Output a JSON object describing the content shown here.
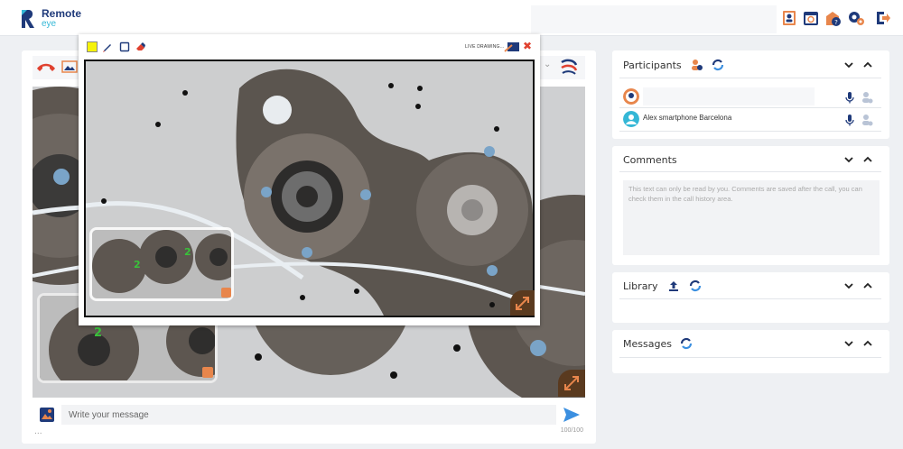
{
  "app": {
    "logo_line1": "Remote",
    "logo_line2": "eye"
  },
  "header": {
    "icons": [
      "contacts-icon",
      "history-icon",
      "help-icon",
      "settings-icon",
      "logout-icon"
    ]
  },
  "call": {
    "toolbar_icons": [
      "hangup-icon",
      "camera-switch-icon",
      "dropdown-icon",
      "brand-icon"
    ],
    "message_placeholder": "Write your message",
    "message_counter": "100/100",
    "message_footer": "..."
  },
  "drawing": {
    "tools": [
      "yellow-color-icon",
      "pen-icon",
      "rectangle-icon",
      "eraser-icon"
    ],
    "live_label": "LIVE DRAWING...",
    "close_label": "✖"
  },
  "participants": {
    "title": "Participants",
    "items": [
      {
        "name": "",
        "avatar": "support-agent-avatar"
      },
      {
        "name": "Alex smartphone Barcelona",
        "avatar": "user-avatar"
      }
    ]
  },
  "comments": {
    "title": "Comments",
    "placeholder": "This text can only be read by you. Comments are saved after the call, you can check them in the call history area."
  },
  "library": {
    "title": "Library"
  },
  "messages": {
    "title": "Messages"
  },
  "colors": {
    "accent": "#1f3a7a",
    "cyan": "#34b7d6",
    "danger": "#e0412f",
    "orange": "#e8864c",
    "send": "#3b8fe0"
  }
}
